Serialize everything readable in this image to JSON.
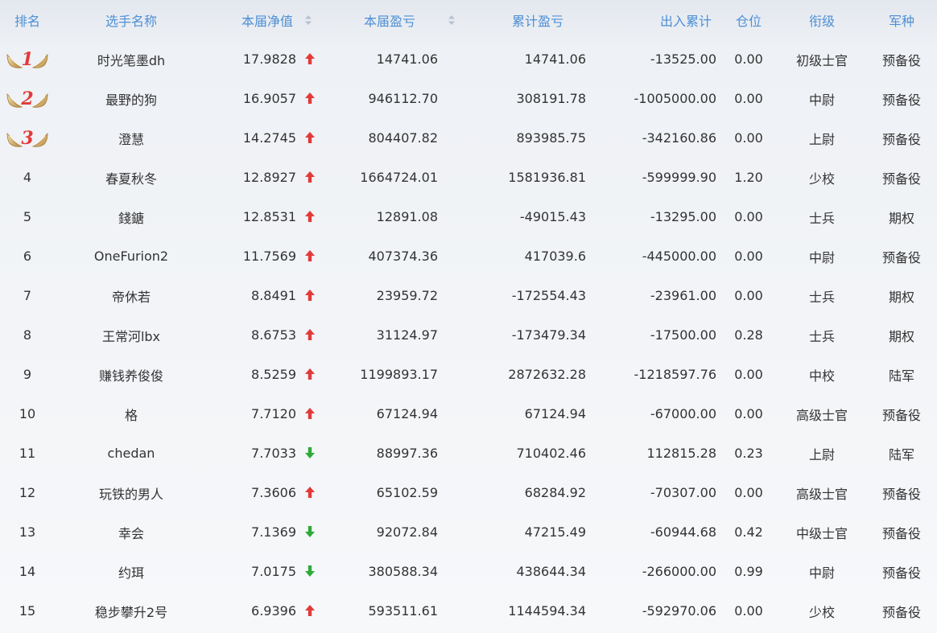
{
  "headers": {
    "rank": "排名",
    "name": "选手名称",
    "nav": "本届净值",
    "profit": "本届盈亏",
    "cumulative": "累计盈亏",
    "flow": "出入累计",
    "position": "仓位",
    "title": "衔级",
    "arm": "军种"
  },
  "icons": {
    "sort": "sort-icon",
    "up": "arrow-up-icon",
    "down": "arrow-down-icon",
    "medal": "winged-medal-icon"
  },
  "colors": {
    "header_text": "#4f8fd4",
    "up": "#e23a3a",
    "down": "#2faa3a",
    "medal_number": "#e23a3a"
  },
  "rows": [
    {
      "rank": "1",
      "name": "时光笔墨dh",
      "nav": "17.9828",
      "trend": "up",
      "profit": "14741.06",
      "cumulative": "14741.06",
      "flow": "-13525.00",
      "position": "0.00",
      "title": "初级士官",
      "arm": "预备役"
    },
    {
      "rank": "2",
      "name": "最野的狗",
      "nav": "16.9057",
      "trend": "up",
      "profit": "946112.70",
      "cumulative": "308191.78",
      "flow": "-1005000.00",
      "position": "0.00",
      "title": "中尉",
      "arm": "预备役"
    },
    {
      "rank": "3",
      "name": "澄慧",
      "nav": "14.2745",
      "trend": "up",
      "profit": "804407.82",
      "cumulative": "893985.75",
      "flow": "-342160.86",
      "position": "0.00",
      "title": "上尉",
      "arm": "预备役"
    },
    {
      "rank": "4",
      "name": "春夏秋冬",
      "nav": "12.8927",
      "trend": "up",
      "profit": "1664724.01",
      "cumulative": "1581936.81",
      "flow": "-599999.90",
      "position": "1.20",
      "title": "少校",
      "arm": "预备役"
    },
    {
      "rank": "5",
      "name": "錢鎕",
      "nav": "12.8531",
      "trend": "up",
      "profit": "12891.08",
      "cumulative": "-49015.43",
      "flow": "-13295.00",
      "position": "0.00",
      "title": "士兵",
      "arm": "期权"
    },
    {
      "rank": "6",
      "name": "OneFurion2",
      "nav": "11.7569",
      "trend": "up",
      "profit": "407374.36",
      "cumulative": "417039.6",
      "flow": "-445000.00",
      "position": "0.00",
      "title": "中尉",
      "arm": "预备役"
    },
    {
      "rank": "7",
      "name": "帝休若",
      "nav": "8.8491",
      "trend": "up",
      "profit": "23959.72",
      "cumulative": "-172554.43",
      "flow": "-23961.00",
      "position": "0.00",
      "title": "士兵",
      "arm": "期权"
    },
    {
      "rank": "8",
      "name": "王常河lbx",
      "nav": "8.6753",
      "trend": "up",
      "profit": "31124.97",
      "cumulative": "-173479.34",
      "flow": "-17500.00",
      "position": "0.28",
      "title": "士兵",
      "arm": "期权"
    },
    {
      "rank": "9",
      "name": "赚钱养俊俊",
      "nav": "8.5259",
      "trend": "up",
      "profit": "1199893.17",
      "cumulative": "2872632.28",
      "flow": "-1218597.76",
      "position": "0.00",
      "title": "中校",
      "arm": "陆军"
    },
    {
      "rank": "10",
      "name": "格",
      "nav": "7.7120",
      "trend": "up",
      "profit": "67124.94",
      "cumulative": "67124.94",
      "flow": "-67000.00",
      "position": "0.00",
      "title": "高级士官",
      "arm": "预备役"
    },
    {
      "rank": "11",
      "name": "chedan",
      "nav": "7.7033",
      "trend": "down",
      "profit": "88997.36",
      "cumulative": "710402.46",
      "flow": "112815.28",
      "position": "0.23",
      "title": "上尉",
      "arm": "陆军"
    },
    {
      "rank": "12",
      "name": "玩铁的男人",
      "nav": "7.3606",
      "trend": "up",
      "profit": "65102.59",
      "cumulative": "68284.92",
      "flow": "-70307.00",
      "position": "0.00",
      "title": "高级士官",
      "arm": "预备役"
    },
    {
      "rank": "13",
      "name": "幸会",
      "nav": "7.1369",
      "trend": "down",
      "profit": "92072.84",
      "cumulative": "47215.49",
      "flow": "-60944.68",
      "position": "0.42",
      "title": "中级士官",
      "arm": "预备役"
    },
    {
      "rank": "14",
      "name": "约珥",
      "nav": "7.0175",
      "trend": "down",
      "profit": "380588.34",
      "cumulative": "438644.34",
      "flow": "-266000.00",
      "position": "0.99",
      "title": "中尉",
      "arm": "预备役"
    },
    {
      "rank": "15",
      "name": "稳步攀升2号",
      "nav": "6.9396",
      "trend": "up",
      "profit": "593511.61",
      "cumulative": "1144594.34",
      "flow": "-592970.06",
      "position": "0.00",
      "title": "少校",
      "arm": "预备役"
    }
  ]
}
